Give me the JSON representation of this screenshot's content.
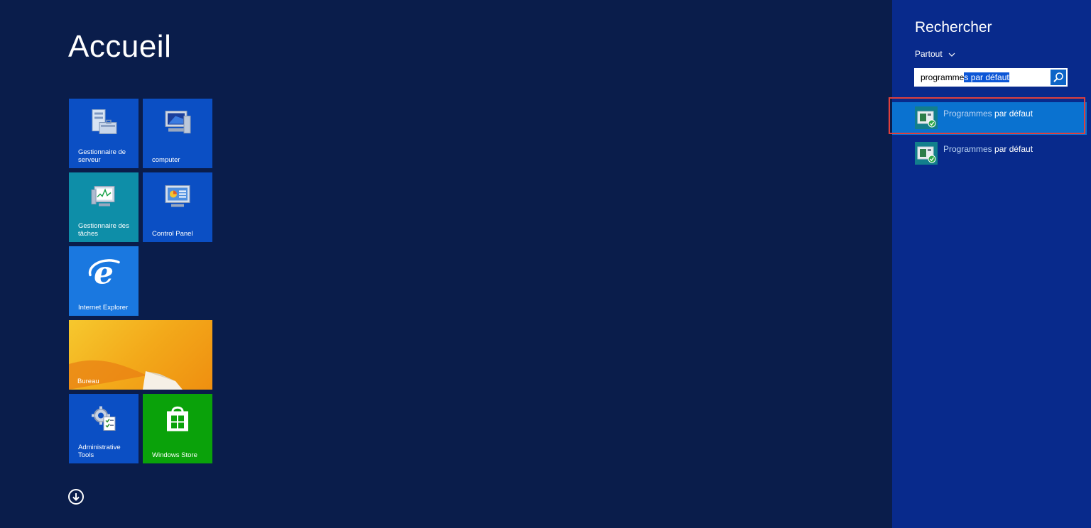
{
  "start": {
    "title": "Accueil",
    "tiles": [
      {
        "id": "server-manager",
        "label": "Gestionnaire de serveur",
        "color": "#0b4fc4"
      },
      {
        "id": "computer",
        "label": "computer",
        "color": "#0b4fc4"
      },
      {
        "id": "task-manager",
        "label": "Gestionnaire des tâches",
        "color": "#0e8ea8"
      },
      {
        "id": "control-panel",
        "label": "Control Panel",
        "color": "#0b4fc4"
      },
      {
        "id": "internet-explorer",
        "label": "Internet Explorer",
        "color": "#1a78e0"
      },
      {
        "id": "desktop",
        "label": "Bureau",
        "color": "#f0a818"
      },
      {
        "id": "administrative-tools",
        "label": "Administrative Tools",
        "color": "#0b4fc4"
      },
      {
        "id": "windows-store",
        "label": "Windows Store",
        "color": "#0aa20a"
      }
    ],
    "all_apps_icon": "arrow-down-circle-icon"
  },
  "search": {
    "title": "Rechercher",
    "scope": "Partout",
    "query_typed": "programme",
    "query_selected": "s par défaut",
    "search_icon": "magnifier-icon",
    "results": [
      {
        "typed": "Programmes",
        "rest": " par défaut",
        "highlighted": true
      },
      {
        "typed": "Programmes",
        "rest": " par défaut",
        "highlighted": false
      }
    ]
  },
  "colors": {
    "start_background": "#0a1d4b",
    "search_background": "#082a8c",
    "result_selected": "#0a72d0",
    "annotation_border": "#e0403d"
  }
}
